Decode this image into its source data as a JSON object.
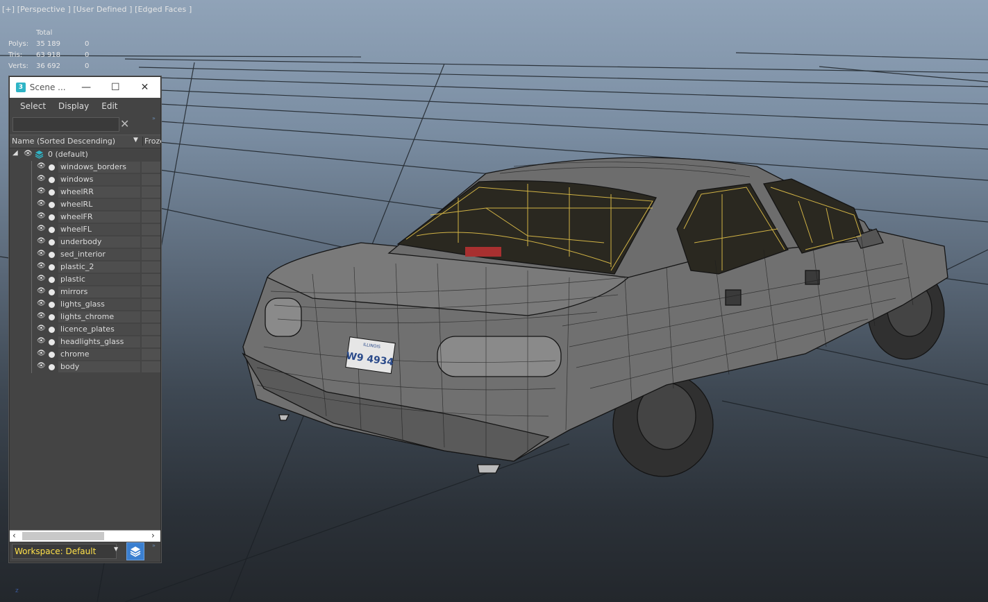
{
  "viewport": {
    "label": "[+] [Perspective ] [User Defined ] [Edged Faces ]",
    "stats": {
      "header": "Total",
      "rows": [
        {
          "label": "Polys:",
          "total": "35 189",
          "selected": "0"
        },
        {
          "label": "Tris:",
          "total": "63 918",
          "selected": "0"
        },
        {
          "label": "Verts:",
          "total": "36 692",
          "selected": "0"
        }
      ]
    },
    "license_plate": "W9 4934",
    "plate_state": "ILLINOIS"
  },
  "scene_explorer": {
    "title": "Scene ...",
    "window_buttons": {
      "minimize": "—",
      "maximize": "☐",
      "close": "✕"
    },
    "menu": [
      "Select",
      "Display",
      "Edit"
    ],
    "search": {
      "value": "",
      "placeholder": ""
    },
    "clear_glyph": "✕",
    "columns": {
      "name": "Name (Sorted Descending)",
      "frozen": "Frozen",
      "sort_glyph": "▼"
    },
    "root": {
      "label": "0 (default)"
    },
    "items": [
      "windows_borders",
      "windows",
      "wheelRR",
      "wheelRL",
      "wheelFR",
      "wheelFL",
      "underbody",
      "sed_interior",
      "plastic_2",
      "plastic",
      "mirrors",
      "lights_glass",
      "lights_chrome",
      "licence_plates",
      "headlights_glass",
      "chrome",
      "body"
    ],
    "workspace": "Workspace: Default",
    "more_glyph": "»"
  },
  "colors": {
    "wire": "#1a1a1a",
    "car_shell": "#6f6f6f",
    "interior_wire": "#e4c34a",
    "selection_yellow": "#ffe14a",
    "accent_blue": "#3b7fd0"
  }
}
